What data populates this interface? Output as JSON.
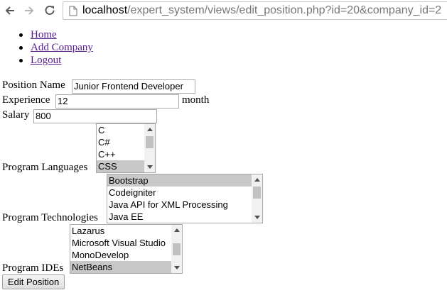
{
  "browser": {
    "url_host": "localhost",
    "url_path": "/expert_system/views/edit_position.php?id=20&company_id=2"
  },
  "nav": [
    "Home",
    "Add Company",
    "Logout"
  ],
  "form": {
    "position_name_label": "Position Name",
    "position_name_value": "Junior Frontend Developer",
    "experience_label": "Experience",
    "experience_value": "12",
    "experience_unit": "month",
    "salary_label": "Salary",
    "salary_value": "800",
    "languages_label": "Program Languages",
    "languages_options": [
      "C",
      "C#",
      "C++",
      "CSS"
    ],
    "languages_selected": "CSS",
    "technologies_label": "Program Technologies",
    "technologies_options": [
      "Bootstrap",
      "Codeigniter",
      "Java API for XML Processing",
      "Java EE"
    ],
    "technologies_selected": "Bootstrap",
    "ides_label": "Program IDEs",
    "ides_options": [
      "Lazarus",
      "Microsoft Visual Studio",
      "MonoDevelop",
      "NetBeans"
    ],
    "ides_selected": "NetBeans",
    "submit_label": "Edit Position"
  }
}
